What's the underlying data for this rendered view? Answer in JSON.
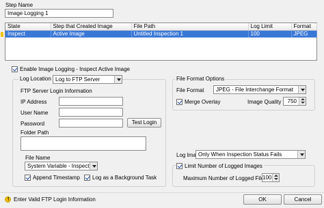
{
  "step_name": {
    "label": "Step Name",
    "value": "Image Logging 1"
  },
  "table": {
    "columns": [
      "State",
      "Step that Created Image",
      "File Path",
      "Log Limit",
      "Format"
    ],
    "rows": [
      {
        "state": "Inspect",
        "step": "Active Image",
        "path": "Untitled Inspection 1",
        "limit": "100",
        "format": "JPEG"
      }
    ]
  },
  "enable_logging": {
    "label": "Enable Image Logging - Inspect Active Image",
    "checked": true
  },
  "log_location": {
    "label": "Log Location",
    "value": "Log to FTP Server"
  },
  "ftp": {
    "title": "FTP Server Login Information",
    "ip_label": "IP Address",
    "user_label": "User Name",
    "password_label": "Password",
    "test_button": "Test Login",
    "folder_label": "Folder Path",
    "file_name_label": "File Name",
    "file_name_value": "System Variable - Inspection",
    "append_timestamp": "Append Timestamp",
    "background_task": "Log as a Background Task"
  },
  "file_format": {
    "title": "File Format Options",
    "format_label": "File Format",
    "format_value": "JPEG - File Interchange Format",
    "merge_overlay": "Merge Overlay",
    "quality_label": "Image Quality",
    "quality_value": "750"
  },
  "log_image": {
    "label": "Log Image",
    "value": "Only When Inspection Status Fails"
  },
  "limit": {
    "label": "Limit Number of Logged Images",
    "max_label": "Maximum Number of Logged Files",
    "max_value": "100"
  },
  "status": {
    "message": "Enter Valid FTP Login Information"
  },
  "buttons": {
    "ok": "OK",
    "cancel": "Cancel"
  },
  "colors": {
    "selection": "#3a78d6",
    "warning": "#f2c200"
  }
}
